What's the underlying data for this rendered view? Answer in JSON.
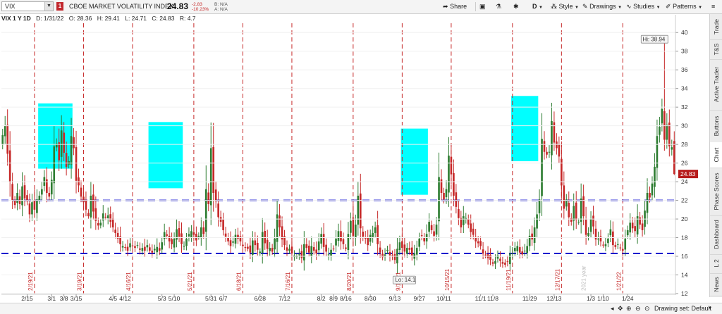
{
  "toolbar": {
    "symbol": "VIX",
    "flag": "1",
    "symbol_name": "CBOE MARKET VOLATILITY INDEX",
    "last": "24.83",
    "change": "-2.83",
    "change_pct": "-10.23%",
    "bid": "B: N/A",
    "ask": "A: N/A",
    "share_label": "Share",
    "period_label": "D",
    "style_label": "Style",
    "drawings_label": "Drawings",
    "studies_label": "Studies",
    "patterns_label": "Patterns"
  },
  "info_bar": {
    "symbol_period": "VIX 1 Y 1D",
    "date": "D: 1/31/22",
    "open": "O: 28.36",
    "high": "H: 29.41",
    "low": "L: 24.71",
    "close": "C: 24.83",
    "range": "R: 4.7"
  },
  "right_tabs": [
    "Trade",
    "T&S",
    "Active Trader",
    "Buttons",
    "Chart",
    "Phase Scores",
    "Dashboard",
    "L 2",
    "News"
  ],
  "active_tab": "Chart",
  "bottom_bar": {
    "drawing_set": "Drawing set: Default"
  },
  "colors": {
    "up": "#2e7d32",
    "down": "#c62828",
    "box": "#00ffff",
    "hline": "#0000cd",
    "vline": "#c62828",
    "price_tag": "#b71c1c"
  },
  "chart_data": {
    "type": "candlestick",
    "y_range": [
      12,
      41
    ],
    "y_ticks": [
      12,
      14,
      16,
      18,
      20,
      22,
      24,
      26,
      28,
      30,
      32,
      34,
      36,
      38,
      40
    ],
    "x_ticks": [
      "2/15",
      "3/1",
      "3/8",
      "3/15",
      "4/5",
      "4/12",
      "5/3",
      "5/10",
      "5/31",
      "6/7",
      "6/28",
      "7/12",
      "8/2",
      "8/9",
      "8/16",
      "8/30",
      "9/13",
      "9/27",
      "10/11",
      "11/1",
      "11/8",
      "11/29",
      "12/13",
      "1/3",
      "1/10",
      "1/24"
    ],
    "date_markers": [
      "2/19/21",
      "3/19/21",
      "4/16/21",
      "5/21/21",
      "6/18/21",
      "7/16/21",
      "8/20/21",
      "9/17/21",
      "10/15/21",
      "11/19/21",
      "12/17/21",
      "1/21/22"
    ],
    "year_label": "2021 year",
    "horizontal_lines": [
      22,
      16.3
    ],
    "highlight_boxes": [
      {
        "from": "2/22",
        "to": "3/12",
        "top": 32.4,
        "bottom": 25.4
      },
      {
        "from": "4/26",
        "to": "5/14",
        "top": 30.4,
        "bottom": 23.3
      },
      {
        "from": "9/17",
        "to": "10/1",
        "top": 29.7,
        "bottom": 22.6
      },
      {
        "from": "11/19",
        "to": "12/3",
        "top": 33.2,
        "bottom": 26.2
      }
    ],
    "high_label": "Hi: 38.94",
    "low_label": "Lo: 14.1",
    "last_price": "24.83",
    "closes": [
      29,
      30,
      27,
      24,
      22,
      21.5,
      22.8,
      21.6,
      23.5,
      22.2,
      21.9,
      20.5,
      21.8,
      21,
      22.1,
      22.5,
      23.2,
      24.5,
      22.8,
      22.4,
      24.2,
      27.8,
      28.1,
      26.3,
      29.5,
      27.1,
      25.6,
      26.2,
      28.9,
      27.6,
      24.1,
      23.6,
      22.4,
      21.8,
      21,
      20.3,
      22.5,
      20.8,
      19.8,
      19.3,
      19.6,
      20.6,
      20.2,
      20.4,
      19.7,
      19.1,
      18.5,
      17.9,
      17.3,
      17.1,
      16.9,
      16.6,
      17.4,
      17.1,
      16.9,
      17.2,
      16.7,
      16.9,
      16.6,
      17.2,
      16.6,
      16.4,
      16.8,
      17,
      16.6,
      17.5,
      18.6,
      18.2,
      17.6,
      17.3,
      17.9,
      18.9,
      18.1,
      17.3,
      17.1,
      17.9,
      18.4,
      18.7,
      18.3,
      17.7,
      18.2,
      19.1,
      18.4,
      23.2,
      21.6,
      27.6,
      22.8,
      21.9,
      20.2,
      19.7,
      18.8,
      18.1,
      17.6,
      17.1,
      17.6,
      18.3,
      17.9,
      17.6,
      17.1,
      16.9,
      16.8,
      16.4,
      17.7,
      17.2,
      16.7,
      16.5,
      18.6,
      17.4,
      16.8,
      16.9,
      16.5,
      17.9,
      20.5,
      19.1,
      17.8,
      17.2,
      16.6,
      16.8,
      16.3,
      16.1,
      16,
      16.2,
      15.8,
      17.3,
      16.9,
      16.4,
      17.1,
      16.6,
      16.3,
      17.6,
      18.4,
      17,
      16.5,
      16.2,
      16.7,
      16.8,
      17.9,
      18.7,
      17.6,
      17.3,
      16.8,
      18.4,
      19.8,
      18.2,
      19.4,
      22.5,
      19,
      18.1,
      17.9,
      17.2,
      18.3,
      18.5,
      19.1,
      17.3,
      16.4,
      15.9,
      16.2,
      16.7,
      16.1,
      16,
      15.6,
      16.8,
      17.5,
      16.9,
      16.5,
      16.9,
      16.7,
      16.1,
      16.3,
      16.9,
      17.9,
      18.2,
      17.6,
      18.4,
      19.7,
      18.8,
      18.2,
      19.4,
      24.5,
      22.8,
      22.1,
      23.2,
      26.8,
      24.8,
      22.5,
      21.3,
      20.1,
      19.1,
      20.3,
      20.1,
      19.4,
      18.6,
      18.3,
      17.6,
      17.4,
      17.1,
      16.3,
      16.1,
      15.8,
      15.6,
      15.2,
      15.5,
      16.1,
      15.5,
      15.2,
      15.1,
      15.4,
      16.3,
      16.3,
      16.9,
      17.1,
      16.4,
      16.2,
      16.6,
      17.1,
      18.2,
      17.8,
      19.1,
      20.5,
      22.1,
      28.6,
      27.2,
      26.9,
      27.2,
      30.5,
      28.2,
      27.6,
      26.7,
      23.6,
      21.1,
      22.1,
      20.2,
      19.7,
      21.4,
      19.9,
      19.7,
      22.2,
      20.3,
      18.3,
      18.5,
      20,
      19.2,
      17.8,
      17.9,
      17.6,
      17.2,
      17.3,
      17.9,
      18.9,
      17.2,
      17,
      17.3,
      16.9,
      16.6,
      17.9,
      18.8,
      19.6,
      19,
      18.7,
      20.3,
      19.4,
      18.8,
      20.9,
      22.8,
      22.3,
      23.8,
      25.6,
      28.9,
      29.9,
      31.8,
      28.5,
      30.1,
      27.8,
      27.7,
      24.83
    ]
  }
}
